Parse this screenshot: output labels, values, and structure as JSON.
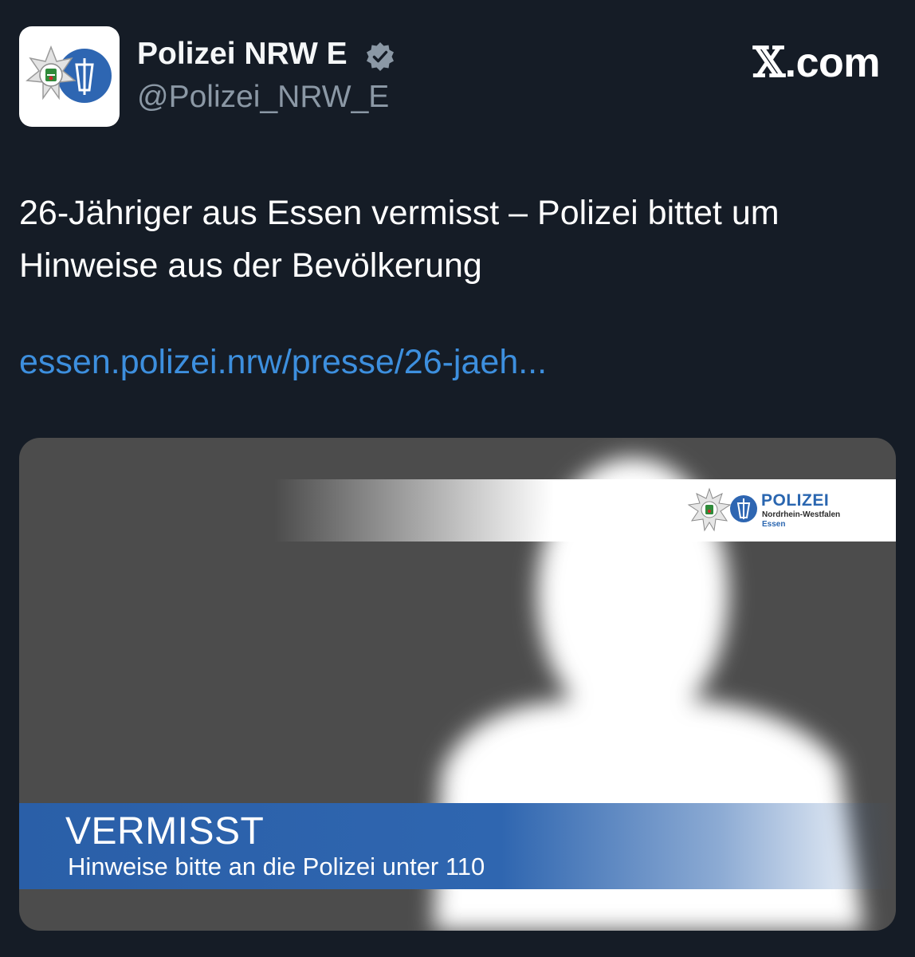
{
  "account": {
    "display_name": "Polizei NRW E",
    "handle": "@Polizei_NRW_E",
    "verified_icon": "verified-badge-icon",
    "avatar_icon": "police-nrw-crest-icon"
  },
  "site": {
    "x_glyph": "𝕏",
    "domain": ".com"
  },
  "post": {
    "text": "26-Jähriger aus Essen vermisst – Polizei bittet um Hinweise aus der Bevölkerung",
    "link": "essen.polizei.nrw/presse/26-jaeh..."
  },
  "media": {
    "logo_title": "POLIZEI",
    "logo_subtitle": "Nordrhein-Westfalen",
    "logo_city": "Essen",
    "banner_title": "VERMISST",
    "banner_text": "Hinweise bitte an die Polizei unter 110",
    "silhouette": "person-silhouette"
  },
  "colors": {
    "background": "#151c26",
    "link": "#3d8fde",
    "handle": "#8b98a5",
    "police_blue": "#2a66b0",
    "media_gray": "#4c4c4c"
  }
}
